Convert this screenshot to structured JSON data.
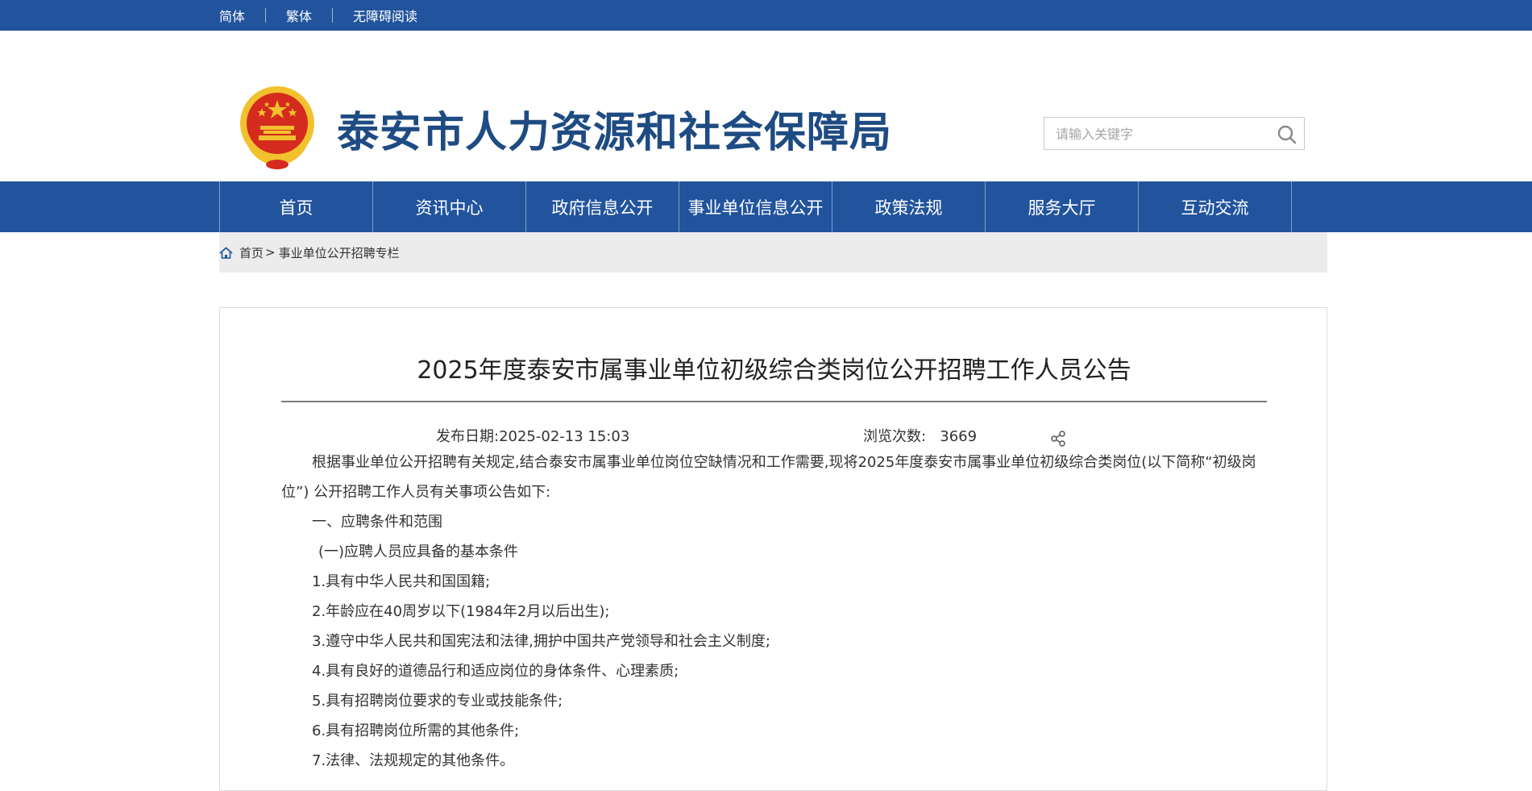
{
  "topbar": {
    "simplified": "简体",
    "traditional": "繁体",
    "accessibility": "无障碍阅读"
  },
  "header": {
    "site_title": "泰安市人力资源和社会保障局",
    "emblem_icon": "national-emblem-icon",
    "search": {
      "placeholder": "请输入关键字",
      "value": "",
      "icon": "search-icon"
    }
  },
  "nav": {
    "items": [
      "首页",
      "资讯中心",
      "政府信息公开",
      "事业单位信息公开",
      "政策法规",
      "服务大厅",
      "互动交流"
    ]
  },
  "breadcrumb": {
    "home": "首页",
    "separator": ">",
    "current": "事业单位公开招聘专栏",
    "icon": "home-icon"
  },
  "article": {
    "title": "2025年度泰安市属事业单位初级综合类岗位公开招聘工作人员公告",
    "publish_label": "发布日期:",
    "publish_date": "2025-02-13 15:03",
    "views_label": "浏览次数:",
    "views": "3669",
    "share_icon": "share-icon",
    "intro": "根据事业单位公开招聘有关规定,结合泰安市属事业单位岗位空缺情况和工作需要,现将2025年度泰安市属事业单位初级综合类岗位(以下简称“初级岗位”) 公开招聘工作人员有关事项公告如下:",
    "section1": "一、应聘条件和范围",
    "subsection1": "(一)应聘人员应具备的基本条件",
    "conditions": [
      "1.具有中华人民共和国国籍;",
      "2.年龄应在40周岁以下(1984年2月以后出生);",
      "3.遵守中华人民共和国宪法和法律,拥护中国共产党领导和社会主义制度;",
      "4.具有良好的道德品行和适应岗位的身体条件、心理素质;",
      "5.具有招聘岗位要求的专业或技能条件;",
      "6.具有招聘岗位所需的其他条件;",
      "7.法律、法规规定的其他条件。"
    ]
  },
  "colors": {
    "brand_blue": "#22549d",
    "title_blue": "#1e4b82",
    "emblem_red": "#d52b1e",
    "emblem_gold": "#f2c12e"
  }
}
